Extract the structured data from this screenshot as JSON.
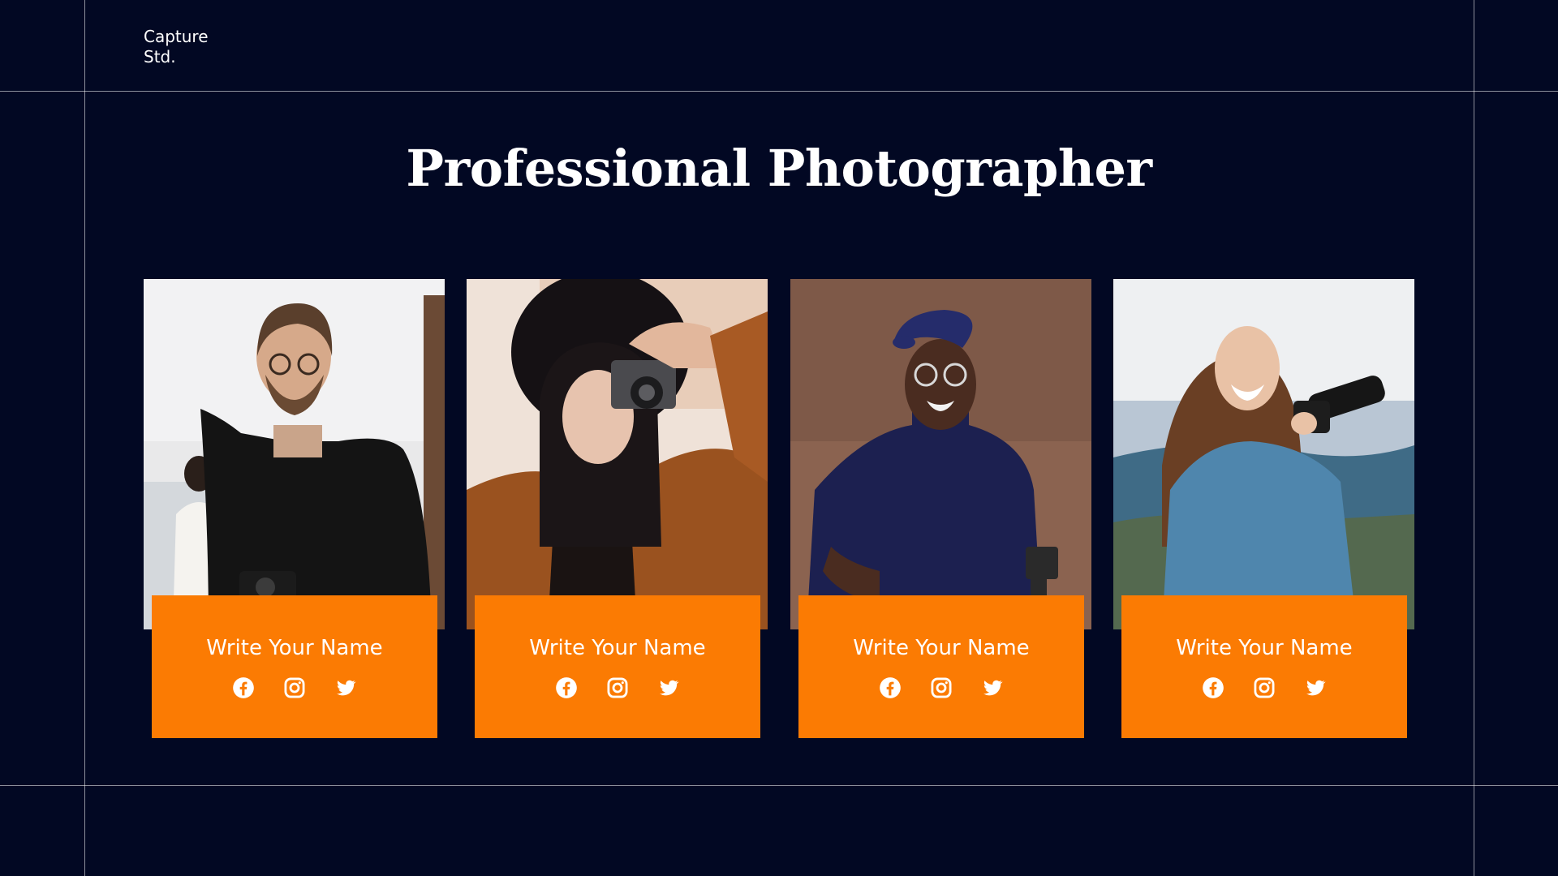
{
  "brand": {
    "line1": "Capture",
    "line2": "Std."
  },
  "title": "Professional Photographer",
  "team": [
    {
      "name": "Write Your Name",
      "photo": "man-with-camera-black-hoodie",
      "icons": [
        "facebook-icon",
        "instagram-icon",
        "twitter-icon"
      ]
    },
    {
      "name": "Write Your Name",
      "photo": "woman-in-hat-holding-camera",
      "icons": [
        "facebook-icon",
        "instagram-icon",
        "twitter-icon"
      ]
    },
    {
      "name": "Write Your Name",
      "photo": "man-in-beret-with-glasses",
      "icons": [
        "facebook-icon",
        "instagram-icon",
        "twitter-icon"
      ]
    },
    {
      "name": "Write Your Name",
      "photo": "woman-in-denim-jacket-with-camera",
      "icons": [
        "facebook-icon",
        "instagram-icon",
        "twitter-icon"
      ]
    }
  ],
  "colors": {
    "background": "#020823",
    "accent": "#fb7b03",
    "text": "#ffffff",
    "grid_lines": "#8a8fa0"
  }
}
